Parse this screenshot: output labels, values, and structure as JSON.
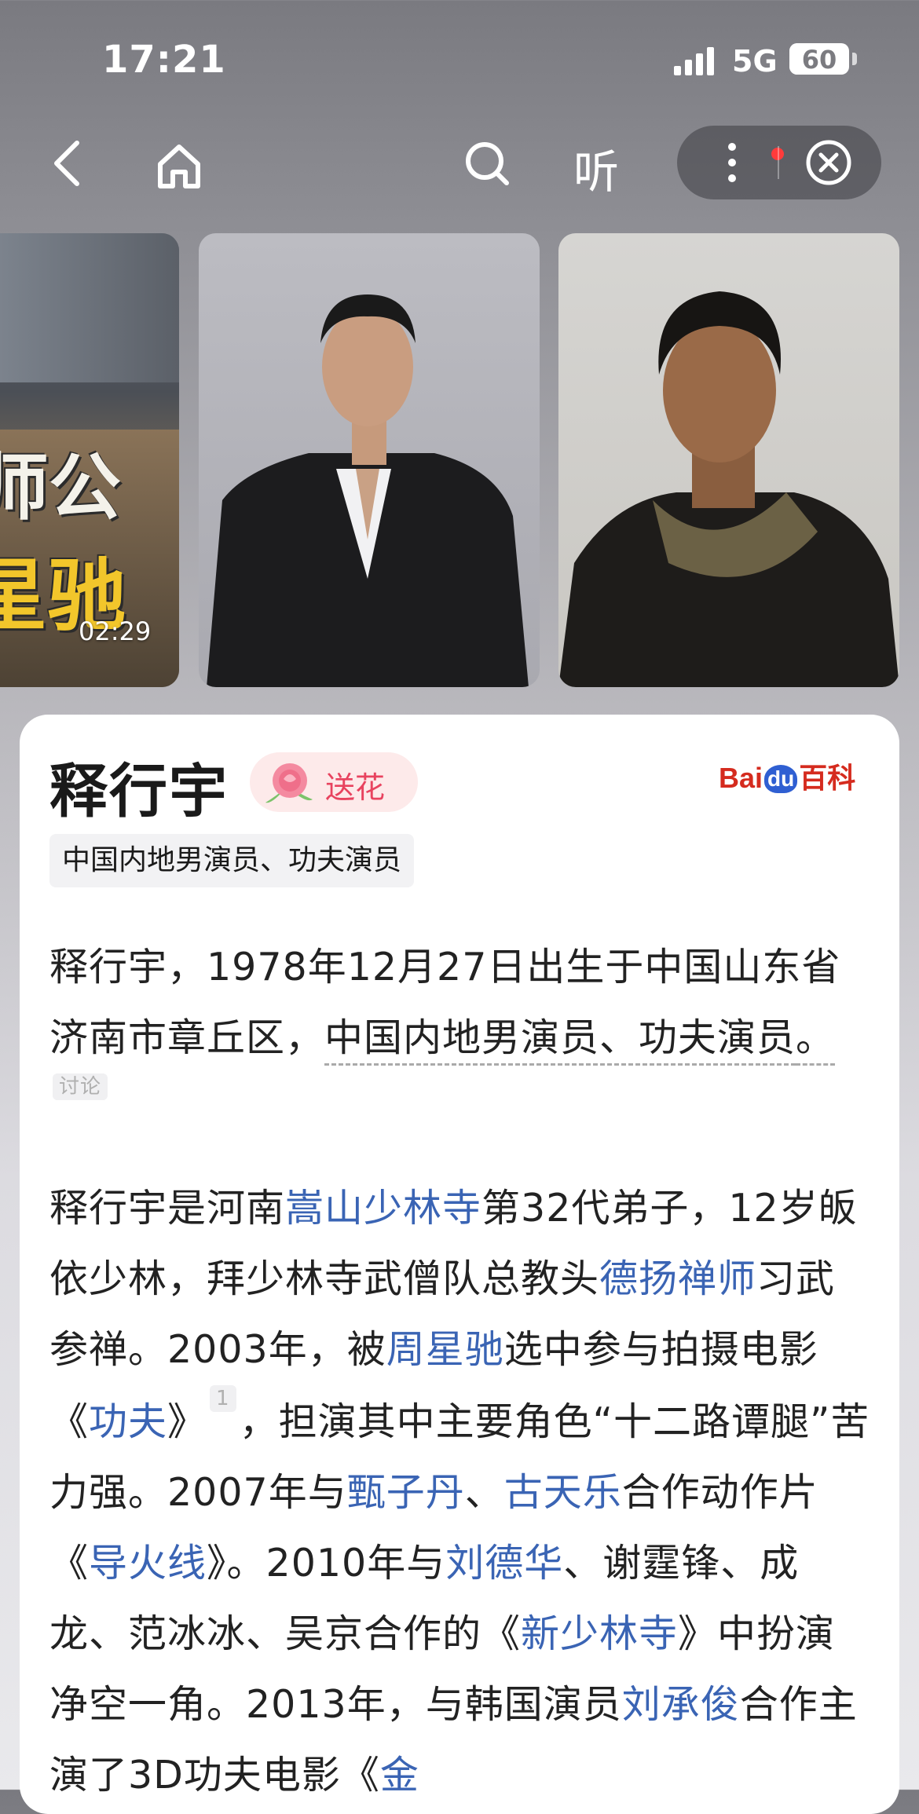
{
  "status_bar": {
    "time": "17:21",
    "network": "5G",
    "battery": "60",
    "battery_level": 0.6
  },
  "nav": {
    "listen_label": "听"
  },
  "photos": {
    "video_text_top": "师公",
    "video_text_bottom": "星驰",
    "video_duration": "02:29"
  },
  "card": {
    "title": "释行宇",
    "flower_label": "送花",
    "source_logo": {
      "left": "Bai",
      "mid": "du",
      "right": "百科"
    },
    "tag": "中国内地男演员、功夫演员",
    "p1": {
      "t1": "释行宇，1978年12月27日出生于中国山东省济南市章丘区，",
      "t2": "中国内地男演员、功夫演员",
      "t3": "。",
      "discuss": "讨论"
    },
    "p2": {
      "t1": "释行宇是河南",
      "l1": "嵩山少林寺",
      "t2": "第32代弟子，12岁皈依少林，拜少林寺武僧队总教头",
      "l2": "德扬禅师",
      "t3": "习武参禅。2003年，被",
      "l3": "周星驰",
      "t4": "选中参与拍摄电影《",
      "l4": "功夫",
      "t5": "》",
      "ref": "1",
      "t6": "，担演其中主要角色“十二路谭腿”苦力强。2007年与",
      "l5": "甄子丹",
      "t7": "、",
      "l6": "古天乐",
      "t8": "合作动作片《",
      "l7": "导火线",
      "t9": "》。2010年与",
      "l8": "刘德华",
      "t10": "、谢霆锋、成龙、范冰冰、吴京合作的《",
      "l9": "新少林寺",
      "t11": "》中扮演净空一角。2013年，与韩国演员",
      "l10": "刘承俊",
      "t12": "合作主演了3D功夫电影《",
      "l11": "金"
    }
  }
}
